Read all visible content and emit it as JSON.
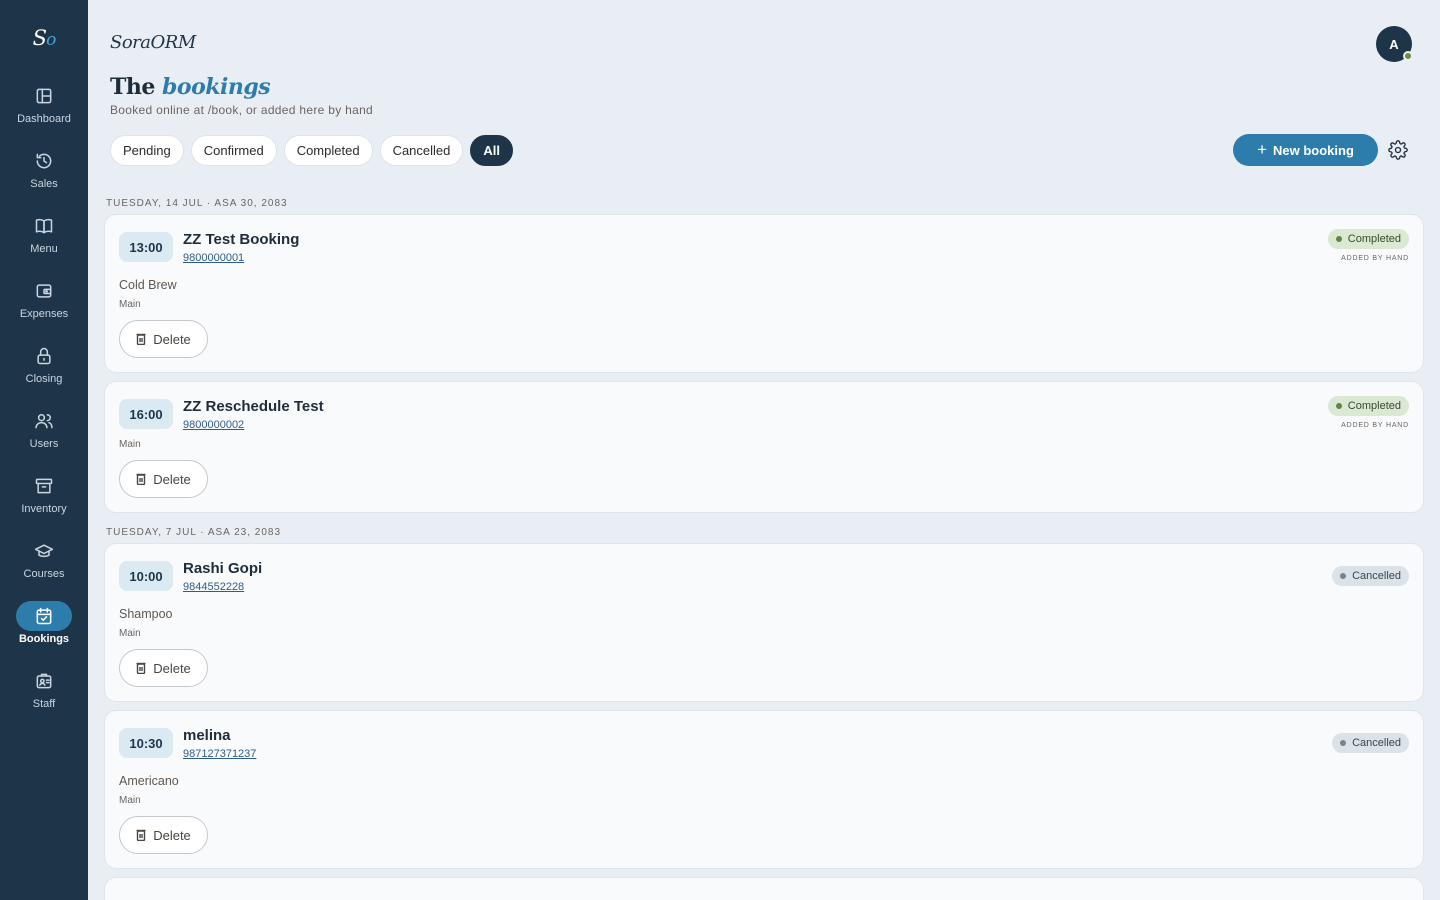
{
  "sidebar": {
    "logo": {
      "s": "S",
      "o": "o"
    },
    "items": [
      {
        "label": "Dashboard",
        "icon": "dashboard-icon",
        "active": false
      },
      {
        "label": "Sales",
        "icon": "history-icon",
        "active": false
      },
      {
        "label": "Menu",
        "icon": "book-icon",
        "active": false
      },
      {
        "label": "Expenses",
        "icon": "wallet-icon",
        "active": false
      },
      {
        "label": "Closing",
        "icon": "lock-icon",
        "active": false
      },
      {
        "label": "Users",
        "icon": "users-icon",
        "active": false
      },
      {
        "label": "Inventory",
        "icon": "archive-icon",
        "active": false
      },
      {
        "label": "Courses",
        "icon": "graduation-cap-icon",
        "active": false
      },
      {
        "label": "Bookings",
        "icon": "calendar-check-icon",
        "active": true
      },
      {
        "label": "Staff",
        "icon": "id-badge-icon",
        "active": false
      }
    ]
  },
  "header": {
    "brand": "SoraORM",
    "avatar_initial": "A",
    "title_plain": "The",
    "title_accent": "bookings",
    "subtitle": "Booked online at /book, or added here by hand"
  },
  "filters": [
    {
      "label": "Pending",
      "active": false
    },
    {
      "label": "Confirmed",
      "active": false
    },
    {
      "label": "Completed",
      "active": false
    },
    {
      "label": "Cancelled",
      "active": false
    },
    {
      "label": "All",
      "active": true
    }
  ],
  "actions": {
    "new_booking_plus": "+",
    "new_booking_label": "New booking"
  },
  "days": [
    {
      "header": "TUESDAY, 14 JUL · ASA 30, 2083",
      "bookings": [
        {
          "time": "13:00",
          "name": "ZZ Test Booking",
          "phone": "9800000001",
          "service": "Cold Brew",
          "location": "Main",
          "status": "Completed",
          "status_kind": "completed",
          "source": "ADDED BY HAND",
          "delete_label": "Delete"
        },
        {
          "time": "16:00",
          "name": "ZZ Reschedule Test",
          "phone": "9800000002",
          "service": "",
          "location": "Main",
          "status": "Completed",
          "status_kind": "completed",
          "source": "ADDED BY HAND",
          "delete_label": "Delete"
        }
      ]
    },
    {
      "header": "TUESDAY, 7 JUL · ASA 23, 2083",
      "bookings": [
        {
          "time": "10:00",
          "name": "Rashi Gopi",
          "phone": "9844552228",
          "service": "Shampoo",
          "location": "Main",
          "status": "Cancelled",
          "status_kind": "cancelled",
          "source": "",
          "delete_label": "Delete"
        },
        {
          "time": "10:30",
          "name": "melina",
          "phone": "987127371237",
          "service": "Americano",
          "location": "Main",
          "status": "Cancelled",
          "status_kind": "cancelled",
          "source": "",
          "delete_label": "Delete"
        }
      ]
    }
  ],
  "colors": {
    "sidebar_bg": "#1e3549",
    "accent": "#2d7dac",
    "completed": "#5b8a3f",
    "cancelled": "#7a838c"
  }
}
